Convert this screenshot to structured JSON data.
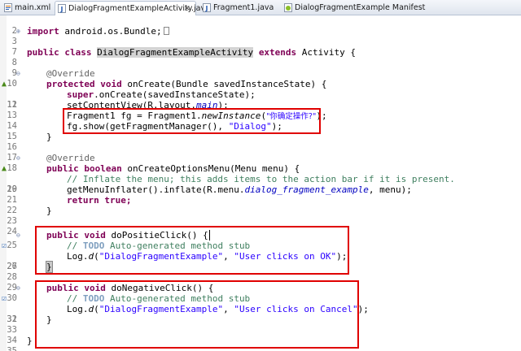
{
  "tabs": [
    {
      "label": "main.xml",
      "active": false,
      "icon": "xml-file-icon"
    },
    {
      "label": "DialogFragmentExampleActivity.java",
      "active": true,
      "icon": "java-file-icon"
    },
    {
      "label": "Fragment1.java",
      "active": false,
      "icon": "java-file-icon"
    },
    {
      "label": "DialogFragmentExample Manifest",
      "active": false,
      "icon": "android-manifest-icon"
    }
  ],
  "tab_close": "×",
  "colors": {
    "keyword": "#7f0055",
    "string": "#2a00ff",
    "comment": "#3f7f5f",
    "annotation": "#646464",
    "highlight_box": "#e00000"
  },
  "code": {
    "ln2": "2",
    "ln3": "3",
    "l3_rest": " android.os.Bundle;",
    "ln7": "7",
    "ln8": "8",
    "l8_class": "DialogFragmentExampleActivity",
    "l8_rest": " Activity {",
    "ln9": "9",
    "ln10": "10",
    "l10_ann": "@Override",
    "ln11": "11",
    "l11_rest": " onCreate(Bundle savedInstanceState) {",
    "ln12": "12",
    "l12_rest": ".onCreate(savedInstanceState);",
    "ln13": "13",
    "l13_a": "setContentView(R.layout.",
    "l13_fld": "main",
    "l13_b": ");",
    "ln14": "14",
    "l14_a": "Fragment1 fg = Fragment1.",
    "l14_sm": "newInstance",
    "l14_b": "(",
    "l14_str": "\"你确定操作?\"",
    "l14_c": ");",
    "ln15": "15",
    "l15_a": "fg.show(getFragmentManager(), ",
    "l15_str": "\"Dialog\"",
    "l15_b": ");",
    "ln16": "16",
    "l16": "}",
    "ln17": "17",
    "ln18": "18",
    "l18_ann": "@Override",
    "ln19": "19",
    "l19_rest": " onCreateOptionsMenu(Menu menu) {",
    "ln20": "20",
    "l20_cmt": "// Inflate the menu; this adds items to the action bar if it is present.",
    "ln21": "21",
    "l21_a": "getMenuInflater().inflate(R.menu.",
    "l21_fld": "dialog_fragment_example",
    "l21_b": ", menu);",
    "ln22": "22",
    "l22_rest": " true;",
    "ln23": "23",
    "l23": "}",
    "ln24": "24",
    "ln25": "25",
    "l25_rest": " doPositieClick() {",
    "ln26": "26",
    "l26_cmt": "// ",
    "l26_todo": "TODO",
    "l26_cmt2": " Auto-generated method stub",
    "ln27": "27",
    "l27_a": "Log.",
    "l27_sm": "d",
    "l27_b": "(",
    "l27_str1": "\"DialogFragmentExample\"",
    "l27_c": ", ",
    "l27_str2": "\"User clicks on OK\"",
    "l27_d": ");",
    "ln28": "28",
    "l28": "}",
    "ln29": "29",
    "ln30": "30",
    "l30_rest": " doNegativeClick() {",
    "ln31": "31",
    "l31_cmt": "// ",
    "l31_todo": "TODO",
    "l31_cmt2": " Auto-generated method stub",
    "ln32": "32",
    "l32_a": "Log.",
    "l32_sm": "d",
    "l32_b": "(",
    "l32_str1": "\"DialogFragmentExample\"",
    "l32_c": ", ",
    "l32_str2": "\"User clicks on Cancel\"",
    "l32_d": ");",
    "ln33": "33",
    "l33": "}",
    "ln34": "34",
    "ln35": "35",
    "l35": "}"
  },
  "keywords": {
    "import": "import",
    "public": "public",
    "class": "class",
    "extends": "extends",
    "protected": "protected",
    "void": "void",
    "super": "super",
    "boolean": "boolean",
    "return": "return"
  }
}
